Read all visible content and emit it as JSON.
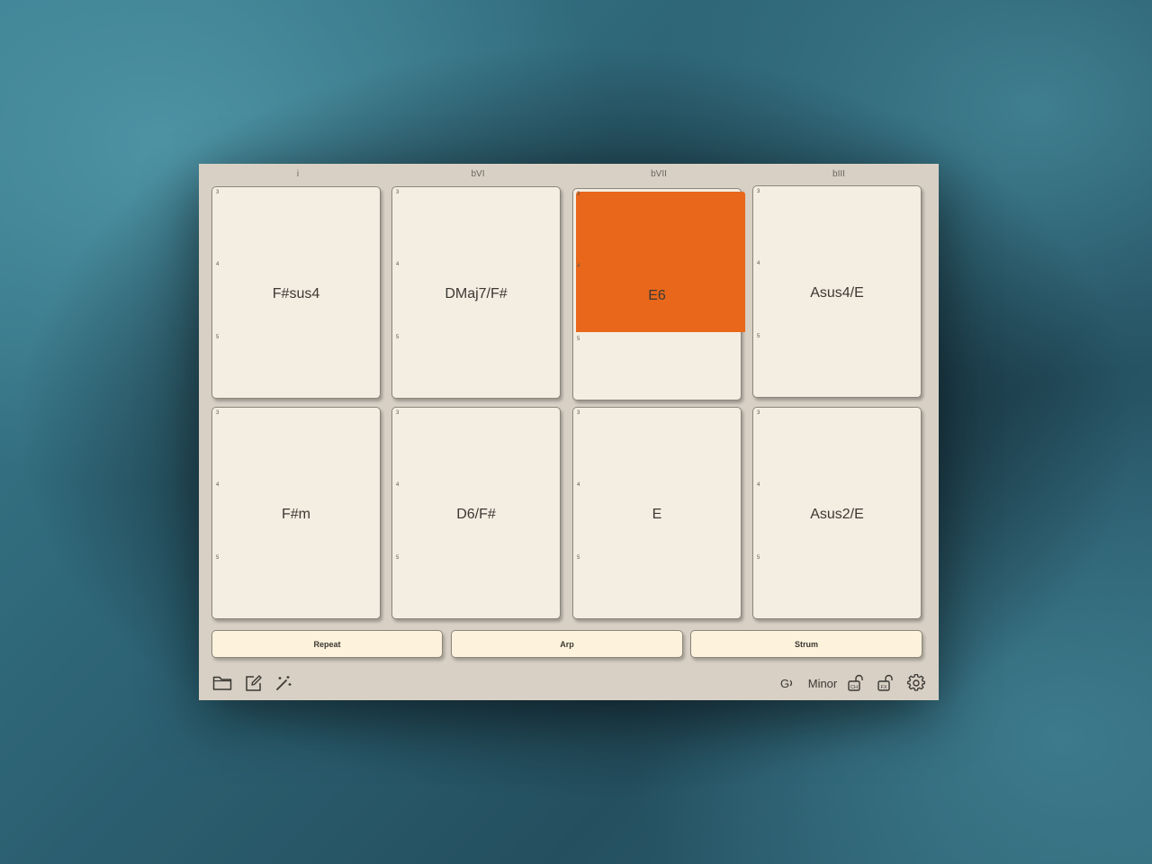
{
  "columns": [
    "i",
    "bVI",
    "bVII",
    "bIII"
  ],
  "frets": [
    "3",
    "4",
    "5"
  ],
  "pads": [
    {
      "name": "F#sus4"
    },
    {
      "name": "DMaj7/F#"
    },
    {
      "name": "E6",
      "active": true,
      "active_color": "#e8671b"
    },
    {
      "name": "Asus4/E"
    },
    {
      "name": "F#m"
    },
    {
      "name": "D6/F#"
    },
    {
      "name": "E"
    },
    {
      "name": "Asus2/E"
    }
  ],
  "modes": {
    "repeat": "Repeat",
    "arp": "Arp",
    "strum": "Strum"
  },
  "toolbar": {
    "key": "G",
    "scale": "Minor",
    "left_icons": [
      "folder-icon",
      "edit-icon",
      "magic-wand-icon"
    ],
    "right_icons": [
      "lock-ch-icon",
      "lock-fx-icon",
      "gear-icon"
    ],
    "lock_ch_label": "CH",
    "lock_fx_label": "FX"
  }
}
